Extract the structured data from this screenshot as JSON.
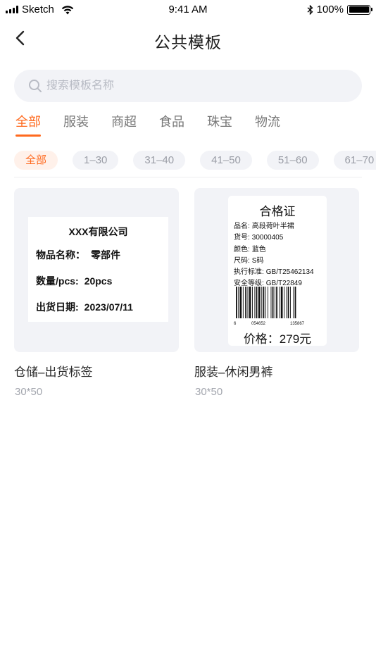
{
  "status_bar": {
    "carrier": "Sketch",
    "time": "9:41 AM",
    "battery": "100%"
  },
  "nav": {
    "title": "公共模板"
  },
  "search": {
    "placeholder": "搜索模板名称"
  },
  "tabs": [
    {
      "label": "全部",
      "active": true
    },
    {
      "label": "服装",
      "active": false
    },
    {
      "label": "商超",
      "active": false
    },
    {
      "label": "食品",
      "active": false
    },
    {
      "label": "珠宝",
      "active": false
    },
    {
      "label": "物流",
      "active": false
    }
  ],
  "size_filters": [
    "全部",
    "1–30",
    "31–40",
    "41–50",
    "51–60",
    "61–70"
  ],
  "templates": [
    {
      "name": "仓储–出货标签",
      "size": "30*50",
      "preview": {
        "heading": "XXX有限公司",
        "rows": [
          {
            "key": "物品名称：",
            "value": "零部件"
          },
          {
            "key": "数量/pcs:",
            "value": "20pcs"
          },
          {
            "key": "出货日期:",
            "value": "2023/07/11"
          }
        ]
      }
    },
    {
      "name": "服装–休闲男裤",
      "size": "30*50",
      "preview": {
        "heading": "合格证",
        "rows": [
          {
            "key": "品名:",
            "value": "高段荷叶半裙"
          },
          {
            "key": "货号:",
            "value": "30000405"
          },
          {
            "key": "颜色:",
            "value": "蓝色"
          },
          {
            "key": "尺码:",
            "value": "S码"
          },
          {
            "key": "执行标准:",
            "value": "GB/T25462134"
          },
          {
            "key": "安全等级:",
            "value": "GB/T22849"
          }
        ],
        "barcode_digits": [
          "6",
          "054652",
          "135867"
        ],
        "price": "价格：279元"
      }
    }
  ],
  "colors": {
    "accent": "#ff6a1f",
    "chip_bg": "#f2f3f7",
    "card_bg": "#f2f3f7"
  }
}
